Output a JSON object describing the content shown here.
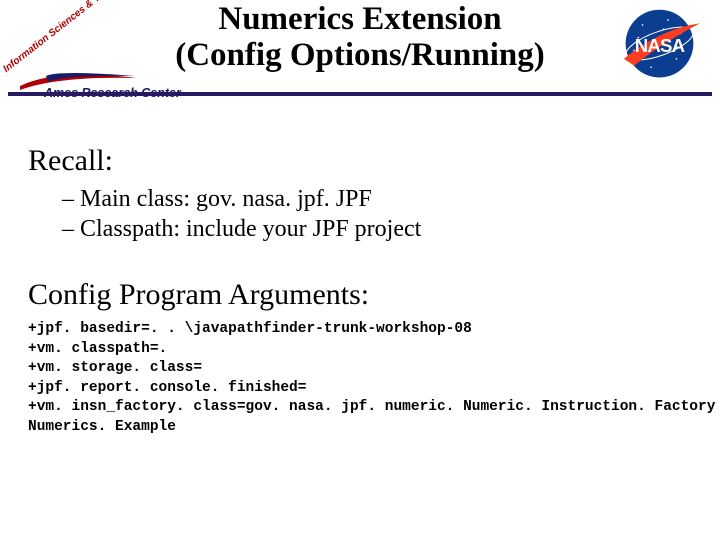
{
  "header": {
    "title_line1": "Numerics Extension",
    "title_line2": "(Config Options/Running)",
    "arc_small_label": "Information Sciences & Technology",
    "arc_name": "Ames Research Center",
    "nasa_word": "NASA"
  },
  "body": {
    "recall_heading": "Recall:",
    "recall_items": [
      "Main class: gov. nasa. jpf. JPF",
      "Classpath: include your JPF project"
    ],
    "config_heading": "Config Program Arguments:",
    "config_lines": [
      "+jpf. basedir=. . \\javapathfinder-trunk-workshop-08",
      "+vm. classpath=.",
      "+vm. storage. class=",
      "+jpf. report. console. finished=",
      "+vm. insn_factory. class=gov. nasa. jpf. numeric. Numeric. Instruction. Factory",
      "Numerics. Example"
    ]
  }
}
